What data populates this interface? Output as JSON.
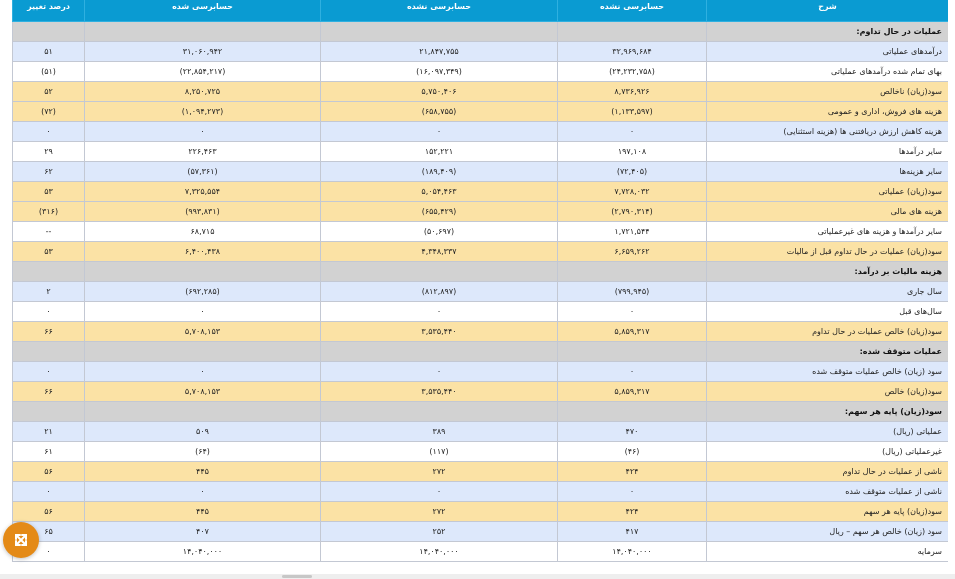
{
  "columns": {
    "desc": "شرح",
    "col1": "حسابرسی نشده",
    "col2": "حسابرسی نشده",
    "col3": "حسابرسی شده",
    "col4": "درصد تغییر"
  },
  "sections": [
    {
      "title": "عملیات در حال تداوم:",
      "rows": [
        {
          "desc": "درآمدهای عملیاتی",
          "c1": "۳۲,۹۶۹,۶۸۴",
          "c2": "۲۱,۸۴۷,۷۵۵",
          "c3": "۳۱,۰۶۰,۹۴۲",
          "c4": "۵۱",
          "style": "blue",
          "neg": []
        },
        {
          "desc": "بهای تمام شده درآمدهای عملیاتی",
          "c1": "(۲۴,۲۳۲,۷۵۸)",
          "c2": "(۱۶,۰۹۷,۳۴۹)",
          "c3": "(۲۲,۸۵۴,۲۱۷)",
          "c4": "(۵۱)",
          "style": "white",
          "neg": [
            "c1",
            "c2",
            "c3",
            "c4"
          ]
        },
        {
          "desc": "سود(زیان) ناخالص",
          "c1": "۸,۷۳۶,۹۲۶",
          "c2": "۵,۷۵۰,۴۰۶",
          "c3": "۸,۲۵۰,۷۲۵",
          "c4": "۵۲",
          "style": "yellow",
          "neg": []
        },
        {
          "desc": "هزینه های فروش، اداری و عمومی",
          "c1": "(۱,۱۳۳,۵۹۷)",
          "c2": "(۶۵۸,۷۵۵)",
          "c3": "(۱,۰۹۴,۲۷۳)",
          "c4": "(۷۲)",
          "style": "yellow",
          "neg": [
            "c1",
            "c2",
            "c3",
            "c4"
          ]
        },
        {
          "desc": "هزینه کاهش ارزش دریافتنی ها (هزینه استثنایی)",
          "c1": "۰",
          "c2": "۰",
          "c3": "۰",
          "c4": "۰",
          "style": "blue",
          "neg": []
        },
        {
          "desc": "سایر درآمدها",
          "c1": "۱۹۷,۱۰۸",
          "c2": "۱۵۲,۲۲۱",
          "c3": "۲۲۶,۴۶۳",
          "c4": "۲۹",
          "style": "white",
          "neg": []
        },
        {
          "desc": "سایر هزینه‌ها",
          "c1": "(۷۲,۴۰۵)",
          "c2": "(۱۸۹,۴۰۹)",
          "c3": "(۵۷,۳۶۱)",
          "c4": "۶۲",
          "style": "blue",
          "neg": [
            "c1",
            "c2",
            "c3"
          ]
        },
        {
          "desc": "سود(زیان) عملیاتی",
          "c1": "۷,۷۲۸,۰۳۲",
          "c2": "۵,۰۵۴,۴۶۳",
          "c3": "۷,۳۲۵,۵۵۴",
          "c4": "۵۳",
          "style": "yellow",
          "neg": []
        },
        {
          "desc": "هزینه های مالی",
          "c1": "(۲,۷۹۰,۳۱۴)",
          "c2": "(۶۵۵,۴۲۹)",
          "c3": "(۹۹۳,۸۳۱)",
          "c4": "(۳۱۶)",
          "style": "yellow",
          "neg": [
            "c1",
            "c2",
            "c3",
            "c4"
          ]
        },
        {
          "desc": "سایر درآمدها و هزینه های غیرعملیاتی",
          "c1": "۱,۷۲۱,۵۴۴",
          "c2": "(۵۰,۶۹۷)",
          "c3": "۶۸,۷۱۵",
          "c4": "--",
          "style": "white",
          "neg": [
            "c2"
          ]
        },
        {
          "desc": "سود(زیان) عملیات در حال تداوم قبل از مالیات",
          "c1": "۶,۶۵۹,۲۶۲",
          "c2": "۴,۳۴۸,۳۳۷",
          "c3": "۶,۴۰۰,۴۳۸",
          "c4": "۵۳",
          "style": "yellow",
          "neg": []
        }
      ]
    },
    {
      "title": "هزینه مالیات بر درآمد:",
      "rows": [
        {
          "desc": "سال جاری",
          "c1": "(۷۹۹,۹۴۵)",
          "c2": "(۸۱۲,۸۹۷)",
          "c3": "(۶۹۲,۲۸۵)",
          "c4": "۲",
          "style": "blue",
          "neg": [
            "c1",
            "c2",
            "c3"
          ]
        },
        {
          "desc": "سال‌های قبل",
          "c1": "۰",
          "c2": "۰",
          "c3": "۰",
          "c4": "۰",
          "style": "white",
          "neg": []
        },
        {
          "desc": "سود(زیان) خالص عملیات در حال تداوم",
          "c1": "۵,۸۵۹,۳۱۷",
          "c2": "۳,۵۳۵,۴۴۰",
          "c3": "۵,۷۰۸,۱۵۳",
          "c4": "۶۶",
          "style": "yellow",
          "neg": []
        }
      ]
    },
    {
      "title": "عملیات متوقف شده:",
      "rows": [
        {
          "desc": "سود (زیان) خالص عملیات متوقف شده",
          "c1": "۰",
          "c2": "۰",
          "c3": "۰",
          "c4": "۰",
          "style": "blue",
          "neg": []
        },
        {
          "desc": "سود(زیان) خالص",
          "c1": "۵,۸۵۹,۳۱۷",
          "c2": "۳,۵۳۵,۴۴۰",
          "c3": "۵,۷۰۸,۱۵۳",
          "c4": "۶۶",
          "style": "yellow",
          "neg": []
        }
      ]
    },
    {
      "title": "سود(زیان) پایه هر سهم:",
      "rows": [
        {
          "desc": "عملیاتی (ریال)",
          "c1": "۴۷۰",
          "c2": "۳۸۹",
          "c3": "۵۰۹",
          "c4": "۲۱",
          "style": "blue",
          "neg": []
        },
        {
          "desc": "غیرعملیاتی (ریال)",
          "c1": "(۴۶)",
          "c2": "(۱۱۷)",
          "c3": "(۶۴)",
          "c4": "۶۱",
          "style": "white",
          "neg": [
            "c1",
            "c2",
            "c3"
          ]
        },
        {
          "desc": "ناشی از عملیات در حال تداوم",
          "c1": "۴۲۴",
          "c2": "۲۷۲",
          "c3": "۴۴۵",
          "c4": "۵۶",
          "style": "yellow",
          "neg": []
        },
        {
          "desc": "ناشی از عملیات متوقف شده",
          "c1": "۰",
          "c2": "۰",
          "c3": "۰",
          "c4": "۰",
          "style": "blue",
          "neg": []
        },
        {
          "desc": "سود(زیان) پایه هر سهم",
          "c1": "۴۲۴",
          "c2": "۲۷۲",
          "c3": "۴۴۵",
          "c4": "۵۶",
          "style": "yellow",
          "neg": []
        },
        {
          "desc": "سود (زیان) خالص هر سهم – ریال",
          "c1": "۴۱۷",
          "c2": "۲۵۲",
          "c3": "۴۰۷",
          "c4": "۶۵",
          "style": "blue",
          "neg": []
        },
        {
          "desc": "سرمایه",
          "c1": "۱۴,۰۴۰,۰۰۰",
          "c2": "۱۴,۰۴۰,۰۰۰",
          "c3": "۱۴,۰۴۰,۰۰۰",
          "c4": "۰",
          "style": "white",
          "neg": []
        }
      ]
    }
  ],
  "fab": {
    "icon": "expand-arrows-icon"
  }
}
